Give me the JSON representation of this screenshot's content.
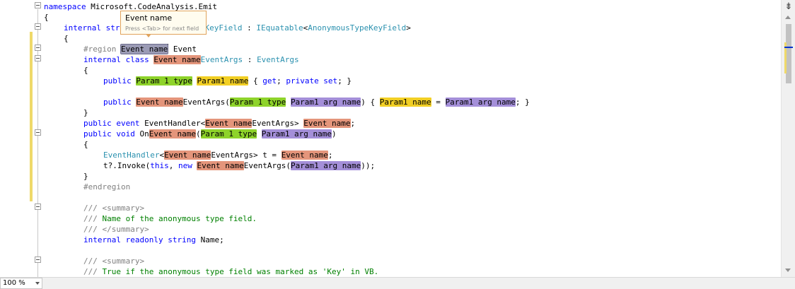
{
  "tooltip": {
    "title": "Event name",
    "hint": "Press <Tab> for next field"
  },
  "zoom": {
    "value": "100 %"
  },
  "code": {
    "l1_ns_kw": "namespace",
    "l1_ns_name": " Microsoft.CodeAnalysis.Emit",
    "l2": "{",
    "l3_kw": "internal",
    "l3_str": " str",
    "l3_type": "KeyField",
    "l3_colon": " : ",
    "l3_iface": "IEquatable",
    "l3_lt": "<",
    "l3_arg": "AnonymousTypeKeyField",
    "l3_gt": ">",
    "l4": "{",
    "l5_region": "#region ",
    "l5_field": "Event name",
    "l5_rest": " Event",
    "l6_kw": "internal class ",
    "l6_field": "Event name",
    "l6_suffix": "EventArgs",
    "l6_colon": " : ",
    "l6_base": "EventArgs",
    "l7": "{",
    "l8_kw": "public ",
    "l8_type": "Param 1 type",
    "l8_name": "Param1 name",
    "l8_rest1": " { ",
    "l8_get": "get",
    "l8_rest2": "; ",
    "l8_priv": "private set",
    "l8_rest3": "; }",
    "l10_kw": "public ",
    "l10_field": "Event name",
    "l10_suffix": "EventArgs(",
    "l10_type": "Param 1 type",
    "l10_arg": "Param1 arg name",
    "l10_mid": ") { ",
    "l10_name": "Param1 name",
    "l10_eq": " = ",
    "l10_arg2": "Param1 arg name",
    "l10_end": "; }",
    "l11": "}",
    "l12_kw": "public event ",
    "l12_handler": "EventHandler<",
    "l12_field": "Event name",
    "l12_suffix": "EventArgs> ",
    "l12_field2": "Event name",
    "l12_end": ";",
    "l13_kw": "public void ",
    "l13_on": "On",
    "l13_field": "Event name",
    "l13_paren": "(",
    "l13_type": "Param 1 type",
    "l13_arg": "Param1 arg name",
    "l13_end": ")",
    "l14": "{",
    "l15_type": "EventHandler",
    "l15_lt": "<",
    "l15_field": "Event name",
    "l15_suffix": "EventArgs> t = ",
    "l15_field2": "Event name",
    "l15_end": ";",
    "l16_pre": "t?.Invoke(",
    "l16_this": "this",
    "l16_comma": ", ",
    "l16_new": "new ",
    "l16_field": "Event name",
    "l16_suffix": "EventArgs(",
    "l16_arg": "Param1 arg name",
    "l16_end": "));",
    "l17": "}",
    "l18_region": "#endregion",
    "l20_slash": "/// ",
    "l20_tag": "<summary>",
    "l21_slash": "/// ",
    "l21_text": "Name of the anonymous type field.",
    "l22_slash": "/// ",
    "l22_tag": "</summary>",
    "l23_kw": "internal readonly string",
    "l23_rest": " Name;",
    "l25_slash": "/// ",
    "l25_tag": "<summary>",
    "l26_slash": "/// ",
    "l26_text": "True if the anonymous type field was marked as 'Key' in VB."
  },
  "colors": {
    "keyword": "#0000ff",
    "type": "#2b91af",
    "comment": "#008000",
    "field_event": "#e4957b",
    "field_type": "#8ed32a",
    "field_name": "#f2cf24",
    "field_arg": "#a48fd9",
    "change_margin": "#efd96a"
  }
}
